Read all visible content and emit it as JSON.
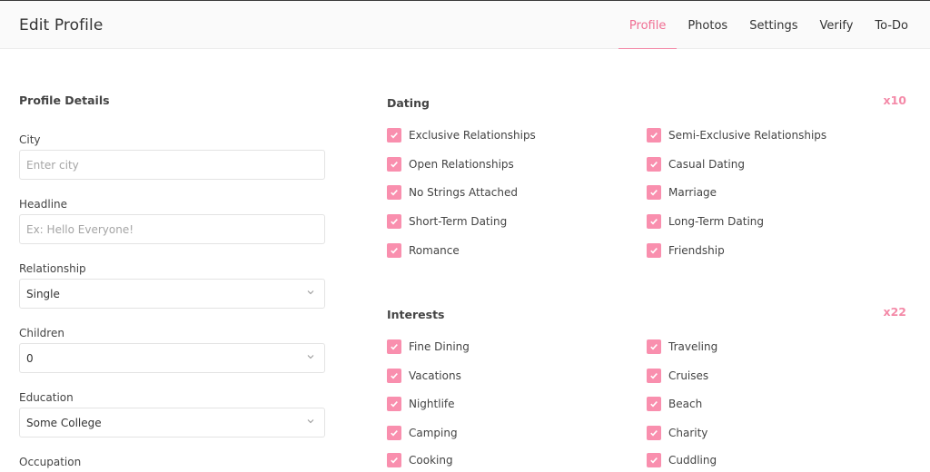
{
  "header": {
    "title": "Edit Profile",
    "tabs": [
      {
        "label": "Profile",
        "active": true
      },
      {
        "label": "Photos",
        "active": false
      },
      {
        "label": "Settings",
        "active": false
      },
      {
        "label": "Verify",
        "active": false
      },
      {
        "label": "To-Do",
        "active": false
      }
    ]
  },
  "profile_details": {
    "title": "Profile Details",
    "fields": [
      {
        "label": "City",
        "type": "text",
        "value": "",
        "placeholder": "Enter city"
      },
      {
        "label": "Headline",
        "type": "text",
        "value": "",
        "placeholder": "Ex: Hello Everyone!"
      },
      {
        "label": "Relationship",
        "type": "select",
        "value": "Single"
      },
      {
        "label": "Children",
        "type": "select",
        "value": "0"
      },
      {
        "label": "Education",
        "type": "select",
        "value": "Some College"
      },
      {
        "label": "Occupation",
        "type": "text",
        "value": ""
      }
    ]
  },
  "dating": {
    "title": "Dating",
    "count": "x10",
    "options": [
      {
        "label": "Exclusive Relationships",
        "checked": true
      },
      {
        "label": "Semi-Exclusive Relationships",
        "checked": true
      },
      {
        "label": "Open Relationships",
        "checked": true
      },
      {
        "label": "Casual Dating",
        "checked": true
      },
      {
        "label": "No Strings Attached",
        "checked": true
      },
      {
        "label": "Marriage",
        "checked": true
      },
      {
        "label": "Short-Term Dating",
        "checked": true
      },
      {
        "label": "Long-Term Dating",
        "checked": true
      },
      {
        "label": "Romance",
        "checked": true
      },
      {
        "label": "Friendship",
        "checked": true
      }
    ]
  },
  "interests": {
    "title": "Interests",
    "count": "x22",
    "options": [
      {
        "label": "Fine Dining",
        "checked": true
      },
      {
        "label": "Traveling",
        "checked": true
      },
      {
        "label": "Vacations",
        "checked": true
      },
      {
        "label": "Cruises",
        "checked": true
      },
      {
        "label": "Nightlife",
        "checked": true
      },
      {
        "label": "Beach",
        "checked": true
      },
      {
        "label": "Camping",
        "checked": true
      },
      {
        "label": "Charity",
        "checked": true
      },
      {
        "label": "Cooking",
        "checked": true
      },
      {
        "label": "Cuddling",
        "checked": true
      }
    ]
  },
  "colors": {
    "accent": "#f06e93",
    "checkbox": "#f98fae"
  }
}
